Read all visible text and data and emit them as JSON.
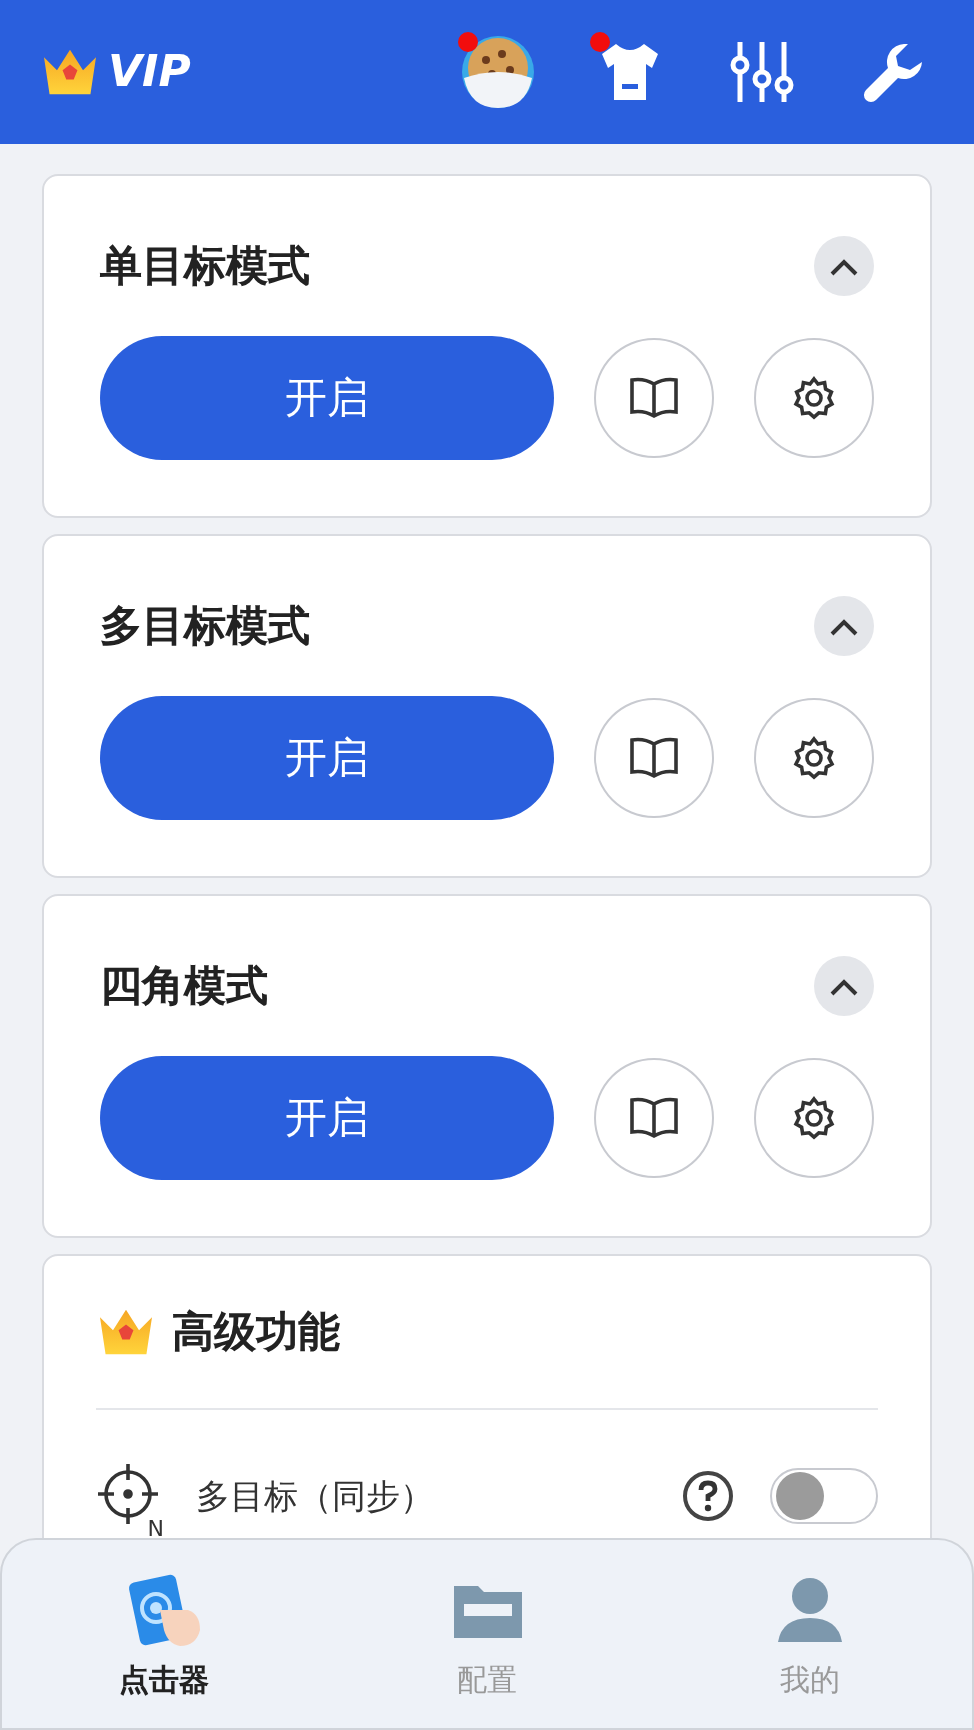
{
  "header": {
    "vip_label": "VIP",
    "icons": [
      {
        "kind": "cookie",
        "dot": true
      },
      {
        "kind": "shirt",
        "dot": true
      },
      {
        "kind": "sliders",
        "dot": false
      },
      {
        "kind": "wrench",
        "dot": false
      }
    ]
  },
  "modes": [
    {
      "title": "单目标模式",
      "expanded": true,
      "button": "开启"
    },
    {
      "title": "多目标模式",
      "expanded": true,
      "button": "开启"
    },
    {
      "title": "四角模式",
      "expanded": true,
      "button": "开启"
    }
  ],
  "advanced": {
    "title": "高级功能",
    "rows": [
      {
        "label": "多目标（同步）",
        "icon_letter": "N",
        "on": false
      }
    ]
  },
  "nav": [
    {
      "label": "点击器",
      "kind": "clicker",
      "selected": true
    },
    {
      "label": "配置",
      "kind": "folder",
      "selected": false
    },
    {
      "label": "我的",
      "kind": "person",
      "selected": false
    }
  ]
}
